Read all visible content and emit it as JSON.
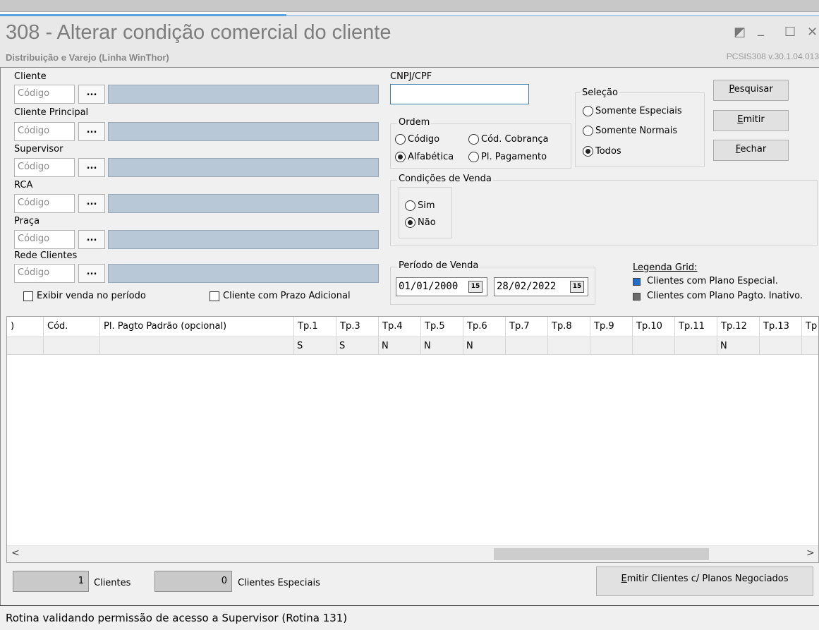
{
  "window": {
    "title": "308 - Alterar condição comercial do cliente",
    "subtitle": "Distribuição e Varejo (Linha WinThor)",
    "version": "PCSIS308  v.30.1.04.013"
  },
  "filters": {
    "cliente_label": "Cliente",
    "cliente_principal_label": "Cliente Principal",
    "supervisor_label": "Supervisor",
    "rca_label": "RCA",
    "praca_label": "Praça",
    "rede_clientes_label": "Rede Clientes",
    "code_placeholder": "Código",
    "lookup_label": "...",
    "exibir_venda_label": "Exibir venda no período",
    "prazo_adicional_label": "Cliente com Prazo Adicional"
  },
  "cnpj": {
    "label": "CNPJ/CPF",
    "value": ""
  },
  "ordem": {
    "title": "Ordem",
    "codigo": "Código",
    "cod_cobranca": "Cód. Cobrança",
    "alfabetica": "Alfabética",
    "pl_pagamento": "Pl. Pagamento",
    "selected": "alfabetica"
  },
  "selecao": {
    "title": "Seleção",
    "somente_especiais": "Somente Especiais",
    "somente_normais": "Somente Normais",
    "todos": "Todos",
    "selected": "todos"
  },
  "condicoes": {
    "title": "Condições de Venda",
    "sim": "Sim",
    "nao": "Não",
    "selected": "nao"
  },
  "periodo": {
    "title": "Período de Venda",
    "start": "01/01/2000",
    "end": "28/02/2022",
    "cal_icon": "15"
  },
  "buttons": {
    "pesquisar": {
      "key": "P",
      "rest": "esquisar"
    },
    "emitir": {
      "key": "E",
      "rest": "mitir"
    },
    "fechar": {
      "key": "F",
      "rest": "echar"
    },
    "emitir_planos": {
      "key": "E",
      "rest": "mitir Clientes c/ Planos Negociados"
    }
  },
  "legenda": {
    "title": "Legenda Grid:",
    "items": [
      {
        "color": "#1f6fd1",
        "label": "Clientes com Plano Especial."
      },
      {
        "color": "#6b6b6b",
        "label": "Clientes com Plano Pagto. Inativo."
      }
    ]
  },
  "grid": {
    "columns": [
      ")",
      "Cód.",
      "Pl. Pagto Padrão (opcional)",
      "Tp.1",
      "Tp.3",
      "Tp.4",
      "Tp.5",
      "Tp.6",
      "Tp.7",
      "Tp.8",
      "Tp.9",
      "Tp.10",
      "Tp.11",
      "Tp.12",
      "Tp.13",
      "Tp"
    ],
    "row": [
      "",
      "",
      "",
      "S",
      "S",
      "N",
      "N",
      "N",
      "",
      "",
      "",
      "",
      "",
      "N",
      "",
      ""
    ],
    "scroll_left": "<",
    "scroll_right": ">"
  },
  "footer": {
    "clientes_count": "1",
    "clientes_label": "Clientes",
    "especiais_count": "0",
    "especiais_label": "Clientes Especiais"
  },
  "status": {
    "text": "Rotina validando permissão de acesso a Supervisor (Rotina 131)"
  }
}
